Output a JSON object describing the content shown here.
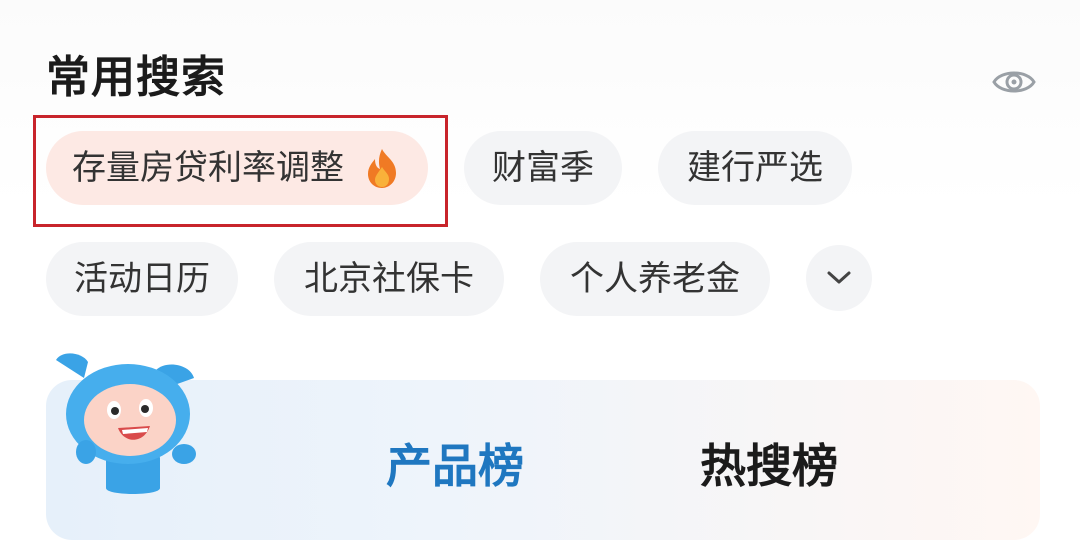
{
  "section": {
    "title": "常用搜索"
  },
  "icons": {
    "visibility": "eye-icon",
    "expand": "chevron-down-icon",
    "hot": "fire-icon"
  },
  "chips": [
    {
      "label": "存量房贷利率调整",
      "hot": true
    },
    {
      "label": "财富季"
    },
    {
      "label": "建行严选"
    },
    {
      "label": "活动日历"
    },
    {
      "label": "北京社保卡"
    },
    {
      "label": "个人养老金"
    }
  ],
  "rank_tabs": [
    {
      "label": "产品榜",
      "active": true
    },
    {
      "label": "热搜榜",
      "active": false
    }
  ],
  "colors": {
    "highlight": "#c8242b",
    "active_tab": "#1f77c0",
    "hot_chip_bg": "#fde9e4"
  }
}
